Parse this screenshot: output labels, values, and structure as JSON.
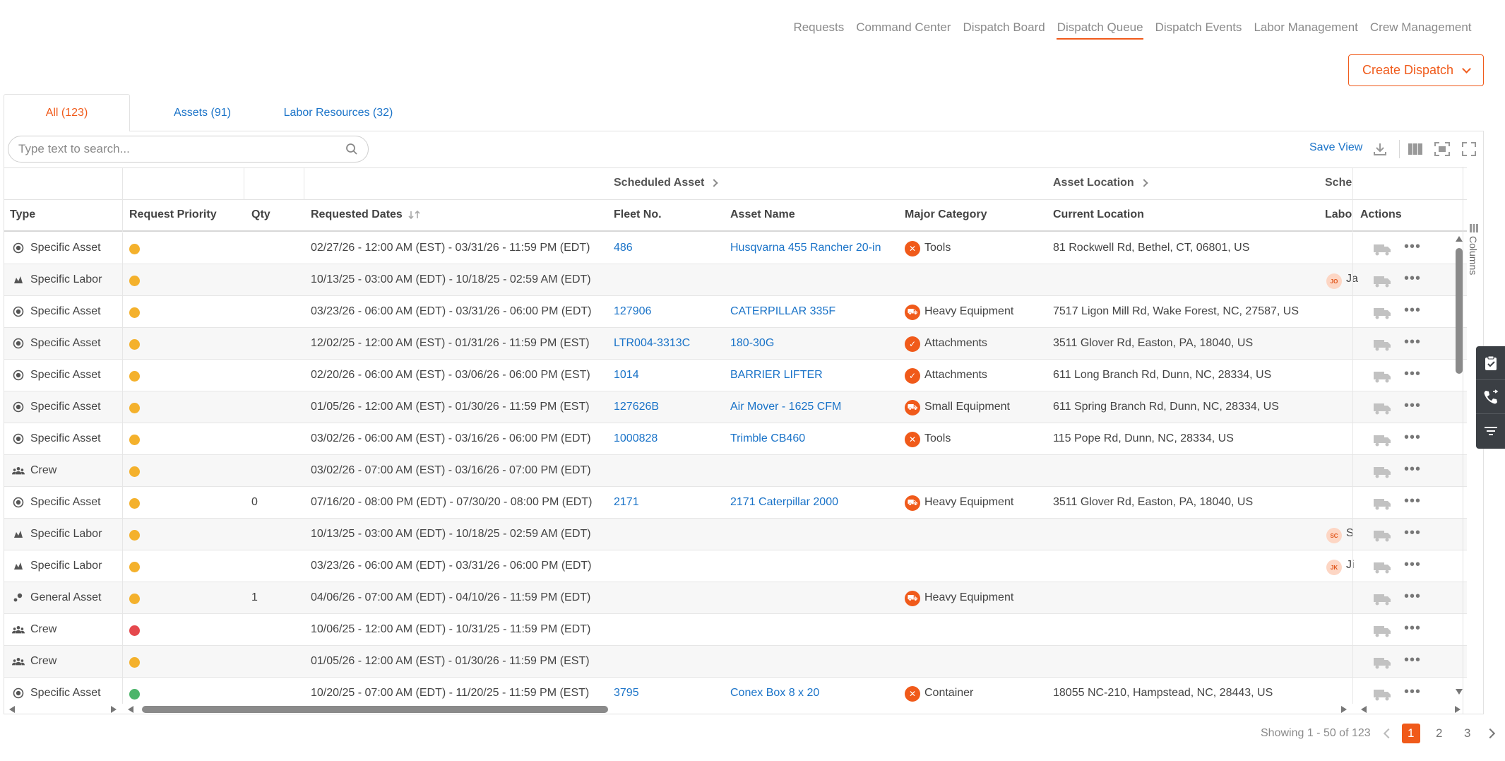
{
  "nav": {
    "items": [
      "Requests",
      "Command Center",
      "Dispatch Board",
      "Dispatch Queue",
      "Dispatch Events",
      "Labor Management",
      "Crew Management"
    ],
    "active": "Dispatch Queue"
  },
  "create_button": "Create Dispatch",
  "tabs": [
    {
      "label": "All (123)",
      "active": true
    },
    {
      "label": "Assets (91)",
      "active": false
    },
    {
      "label": "Labor Resources (32)",
      "active": false
    }
  ],
  "search": {
    "placeholder": "Type text to search...",
    "value": ""
  },
  "toolbar": {
    "save_view": "Save View"
  },
  "groups": {
    "scheduled_asset": "Scheduled Asset",
    "asset_location": "Asset Location",
    "scheduled_partial": "Sche"
  },
  "headers": {
    "type": "Type",
    "priority": "Request Priority",
    "qty": "Qty",
    "dates": "Requested Dates",
    "fleet": "Fleet No.",
    "asset_name": "Asset Name",
    "category": "Major Category",
    "location": "Current Location",
    "labor": "Labor",
    "actions": "Actions"
  },
  "colors": {
    "accent": "#f05a1a",
    "link": "#1a73c8",
    "priority_yellow": "#f4b12c",
    "priority_red": "#e5484d",
    "priority_green": "#4cb56a"
  },
  "rows": [
    {
      "type": "Specific Asset",
      "icon": "target-icon",
      "priority": "yellow",
      "qty": "",
      "dates": "02/27/26 - 12:00 AM (EST) - 03/31/26 - 11:59 PM (EDT)",
      "fleet": "486",
      "asset": "Husqvarna 455 Rancher 20-in",
      "category": "Tools",
      "location": "81 Rockwell Rd, Bethel, CT, 06801, US",
      "labor_initials": "",
      "labor_tail": ""
    },
    {
      "type": "Specific Labor",
      "icon": "labor-icon",
      "priority": "yellow",
      "qty": "",
      "dates": "10/13/25 - 03:00 AM (EDT) - 10/18/25 - 02:59 AM (EDT)",
      "fleet": "",
      "asset": "",
      "category": "",
      "location": "",
      "labor_initials": "JO",
      "labor_tail": "Ja"
    },
    {
      "type": "Specific Asset",
      "icon": "target-icon",
      "priority": "yellow",
      "qty": "",
      "dates": "03/23/26 - 06:00 AM (EDT) - 03/31/26 - 06:00 PM (EDT)",
      "fleet": "127906",
      "asset": "CATERPILLAR 335F",
      "category": "Heavy Equipment",
      "location": "7517 Ligon Mill Rd, Wake Forest, NC, 27587, US",
      "labor_initials": "",
      "labor_tail": ""
    },
    {
      "type": "Specific Asset",
      "icon": "target-icon",
      "priority": "yellow",
      "qty": "",
      "dates": "12/02/25 - 12:00 AM (EST) - 01/31/26 - 11:59 PM (EST)",
      "fleet": "LTR004-3313C",
      "asset": "180-30G",
      "category": "Attachments",
      "location": "3511 Glover Rd, Easton, PA, 18040, US",
      "labor_initials": "",
      "labor_tail": ""
    },
    {
      "type": "Specific Asset",
      "icon": "target-icon",
      "priority": "yellow",
      "qty": "",
      "dates": "02/20/26 - 06:00 AM (EST) - 03/06/26 - 06:00 PM (EST)",
      "fleet": "1014",
      "asset": "BARRIER LIFTER",
      "category": "Attachments",
      "location": "611 Long Branch Rd, Dunn, NC, 28334, US",
      "labor_initials": "",
      "labor_tail": ""
    },
    {
      "type": "Specific Asset",
      "icon": "target-icon",
      "priority": "yellow",
      "qty": "",
      "dates": "01/05/26 - 12:00 AM (EST) - 01/30/26 - 11:59 PM (EST)",
      "fleet": "127626B",
      "asset": "Air Mover - 1625 CFM",
      "category": "Small Equipment",
      "location": "611 Spring Branch Rd, Dunn, NC, 28334, US",
      "labor_initials": "",
      "labor_tail": ""
    },
    {
      "type": "Specific Asset",
      "icon": "target-icon",
      "priority": "yellow",
      "qty": "",
      "dates": "03/02/26 - 06:00 AM (EST) - 03/16/26 - 06:00 PM (EDT)",
      "fleet": "1000828",
      "asset": "Trimble CB460",
      "category": "Tools",
      "location": "115 Pope Rd, Dunn, NC, 28334, US",
      "labor_initials": "",
      "labor_tail": ""
    },
    {
      "type": "Crew",
      "icon": "crew-icon",
      "priority": "yellow",
      "qty": "",
      "dates": "03/02/26 - 07:00 AM (EST) - 03/16/26 - 07:00 PM (EDT)",
      "fleet": "",
      "asset": "",
      "category": "",
      "location": "",
      "labor_initials": "",
      "labor_tail": ""
    },
    {
      "type": "Specific Asset",
      "icon": "target-icon",
      "priority": "yellow",
      "qty": "0",
      "dates": "07/16/20 - 08:00 PM (EDT) - 07/30/20 - 08:00 PM (EDT)",
      "fleet": "2171",
      "asset": "2171 Caterpillar 2000",
      "category": "Heavy Equipment",
      "location": "3511 Glover Rd, Easton, PA, 18040, US",
      "labor_initials": "",
      "labor_tail": ""
    },
    {
      "type": "Specific Labor",
      "icon": "labor-icon",
      "priority": "yellow",
      "qty": "",
      "dates": "10/13/25 - 03:00 AM (EDT) - 10/18/25 - 02:59 AM (EDT)",
      "fleet": "",
      "asset": "",
      "category": "",
      "location": "",
      "labor_initials": "SC",
      "labor_tail": "S"
    },
    {
      "type": "Specific Labor",
      "icon": "labor-icon",
      "priority": "yellow",
      "qty": "",
      "dates": "03/23/26 - 06:00 AM (EDT) - 03/31/26 - 06:00 PM (EDT)",
      "fleet": "",
      "asset": "",
      "category": "",
      "location": "",
      "labor_initials": "JK",
      "labor_tail": "Ji"
    },
    {
      "type": "General Asset",
      "icon": "general-asset-icon",
      "priority": "yellow",
      "qty": "1",
      "dates": "04/06/26 - 07:00 AM (EDT) - 04/10/26 - 11:59 PM (EDT)",
      "fleet": "",
      "asset": "",
      "category": "Heavy Equipment",
      "location": "",
      "labor_initials": "",
      "labor_tail": ""
    },
    {
      "type": "Crew",
      "icon": "crew-icon",
      "priority": "red",
      "qty": "",
      "dates": "10/06/25 - 12:00 AM (EDT) - 10/31/25 - 11:59 PM (EDT)",
      "fleet": "",
      "asset": "",
      "category": "",
      "location": "",
      "labor_initials": "",
      "labor_tail": ""
    },
    {
      "type": "Crew",
      "icon": "crew-icon",
      "priority": "yellow",
      "qty": "",
      "dates": "01/05/26 - 12:00 AM (EST) - 01/30/26 - 11:59 PM (EST)",
      "fleet": "",
      "asset": "",
      "category": "",
      "location": "",
      "labor_initials": "",
      "labor_tail": ""
    },
    {
      "type": "Specific Asset",
      "icon": "target-icon",
      "priority": "green",
      "qty": "",
      "dates": "10/20/25 - 07:00 AM (EDT) - 11/20/25 - 11:59 PM (EST)",
      "fleet": "3795",
      "asset": "Conex Box 8 x 20",
      "category": "Container",
      "location": "18055 NC-210, Hampstead, NC, 28443, US",
      "labor_initials": "",
      "labor_tail": ""
    }
  ],
  "column_panel_label": "Columns",
  "pager": {
    "summary": "Showing 1 - 50 of 123",
    "pages": [
      "1",
      "2",
      "3"
    ],
    "current": "1"
  }
}
